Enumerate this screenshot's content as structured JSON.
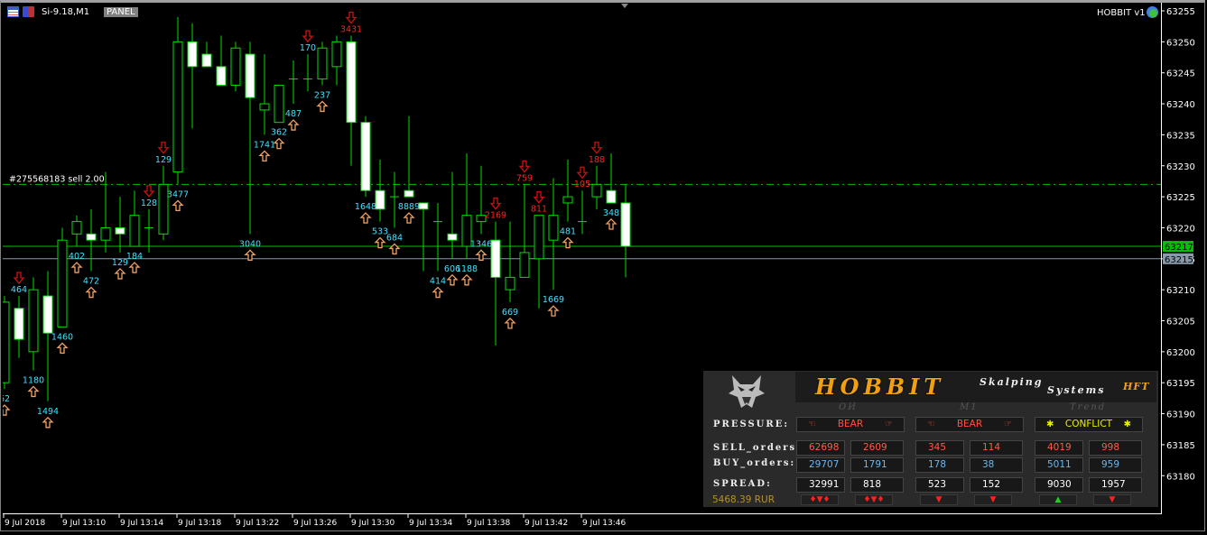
{
  "header": {
    "symbol": "Si-9.18,M1",
    "panel_button": "PANEL",
    "ea_name": "HOBBIT v1"
  },
  "order_line": {
    "label": "#275568183 sell 2.00",
    "price": 63227
  },
  "colors": {
    "bull_outline": "#00e000",
    "bear_fill": "#ffffff",
    "bid_line": "#00c000",
    "ask_line": "#8899aa",
    "up_label": "#40e0ff",
    "down_label": "#ff2020",
    "brand": "#f0a010"
  },
  "chart_data": {
    "type": "candlestick",
    "ylim": [
      63176,
      63256
    ],
    "y_ticks": [
      "63255",
      "63250",
      "63245",
      "63240",
      "63235",
      "63230",
      "63225",
      "63220",
      "63215",
      "63210",
      "63205",
      "63200",
      "63195",
      "63190",
      "63185",
      "63180"
    ],
    "x_ticks": [
      "9 Jul 2018",
      "9 Jul 13:10",
      "9 Jul 13:14",
      "9 Jul 13:18",
      "9 Jul 13:22",
      "9 Jul 13:26",
      "9 Jul 13:30",
      "9 Jul 13:34",
      "9 Jul 13:38",
      "9 Jul 13:42",
      "9 Jul 13:46"
    ],
    "bid_price": "63217",
    "ask_price": "63215",
    "candles": [
      [
        63195,
        63209,
        63194,
        63208
      ],
      [
        63207,
        63209,
        63199,
        63202
      ],
      [
        63200,
        63212,
        63197,
        63210
      ],
      [
        63209,
        63213,
        63192,
        63203
      ],
      [
        63204,
        63220,
        63204,
        63218
      ],
      [
        63219,
        63222,
        63217,
        63221
      ],
      [
        63219,
        63223,
        63213,
        63218
      ],
      [
        63218,
        63229,
        63216,
        63220
      ],
      [
        63220,
        63225,
        63216,
        63219
      ],
      [
        63217,
        63226,
        63217,
        63222
      ],
      [
        63220,
        63223,
        63216,
        63220
      ],
      [
        63219,
        63230,
        63218,
        63227
      ],
      [
        63229,
        63254,
        63227,
        63250
      ],
      [
        63250,
        63253,
        63236,
        63246
      ],
      [
        63248,
        63250,
        63246,
        63246
      ],
      [
        63246,
        63251,
        63243,
        63243
      ],
      [
        63243,
        63250,
        63242,
        63249
      ],
      [
        63248,
        63250,
        63219,
        63241
      ],
      [
        63239,
        63248,
        63235,
        63240
      ],
      [
        63237,
        63243,
        63237,
        63243
      ],
      [
        63244,
        63247,
        63240,
        63244
      ],
      [
        63244,
        63248,
        63242,
        63244
      ],
      [
        63244,
        63250,
        63243,
        63249
      ],
      [
        63246,
        63251,
        63243,
        63250
      ],
      [
        63250,
        63251,
        63230,
        63237
      ],
      [
        63237,
        63238,
        63225,
        63226
      ],
      [
        63226,
        63231,
        63221,
        63223
      ],
      [
        63225,
        63229,
        63220,
        63225
      ],
      [
        63226,
        63238,
        63225,
        63225
      ],
      [
        63224,
        63224,
        63213,
        63223
      ],
      [
        63221,
        63224,
        63213,
        63221
      ],
      [
        63219,
        63229,
        63215,
        63218
      ],
      [
        63217,
        63232,
        63215,
        63222
      ],
      [
        63221,
        63230,
        63219,
        63222
      ],
      [
        63218,
        63221,
        63201,
        63212
      ],
      [
        63210,
        63221,
        63208,
        63212
      ],
      [
        63212,
        63227,
        63212,
        63216
      ],
      [
        63215,
        63222,
        63207,
        63222
      ],
      [
        63218,
        63228,
        63210,
        63222
      ],
      [
        63224,
        63231,
        63221,
        63225
      ],
      [
        63221,
        63226,
        63219,
        63221
      ],
      [
        63225,
        63230,
        63223,
        63227
      ],
      [
        63226,
        63232,
        63224,
        63224
      ],
      [
        63224,
        63227,
        63212,
        63217
      ]
    ],
    "signals": [
      {
        "candle": 0,
        "dir": "up",
        "label": "62"
      },
      {
        "candle": 1,
        "dir": "down",
        "label": "464",
        "label_color": "cyan"
      },
      {
        "candle": 2,
        "dir": "up",
        "label": "1180"
      },
      {
        "candle": 3,
        "dir": "up",
        "label": "1494"
      },
      {
        "candle": 4,
        "dir": "up",
        "label": "1460"
      },
      {
        "candle": 5,
        "dir": "up",
        "label": "402"
      },
      {
        "candle": 6,
        "dir": "up",
        "label": "472"
      },
      {
        "candle": 8,
        "dir": "up",
        "label": "129"
      },
      {
        "candle": 9,
        "dir": "up",
        "label": "184"
      },
      {
        "candle": 10,
        "dir": "down",
        "label": "128",
        "label_color": "cyan"
      },
      {
        "candle": 11,
        "dir": "down",
        "label": "129",
        "label_color": "cyan"
      },
      {
        "candle": 12,
        "dir": "up",
        "label": "3477"
      },
      {
        "candle": 17,
        "dir": "up",
        "label": "3040"
      },
      {
        "candle": 18,
        "dir": "up",
        "label": "1741"
      },
      {
        "candle": 19,
        "dir": "up",
        "label": "362"
      },
      {
        "candle": 20,
        "dir": "up",
        "label": "487"
      },
      {
        "candle": 21,
        "dir": "down",
        "label": "170",
        "label_color": "cyan"
      },
      {
        "candle": 22,
        "dir": "up",
        "label": "237"
      },
      {
        "candle": 24,
        "dir": "down",
        "label": "3431",
        "label_color": "red"
      },
      {
        "candle": 25,
        "dir": "up",
        "label": "1648"
      },
      {
        "candle": 26,
        "dir": "up",
        "label": "533"
      },
      {
        "candle": 27,
        "dir": "up",
        "label": "684"
      },
      {
        "candle": 28,
        "dir": "up",
        "label": "8889"
      },
      {
        "candle": 30,
        "dir": "up",
        "label": "414"
      },
      {
        "candle": 31,
        "dir": "up",
        "label": "606"
      },
      {
        "candle": 32,
        "dir": "up",
        "label": "1188"
      },
      {
        "candle": 33,
        "dir": "up",
        "label": "1346"
      },
      {
        "candle": 34,
        "dir": "down",
        "label": "2169",
        "label_color": "red"
      },
      {
        "candle": 35,
        "dir": "up",
        "label": "669"
      },
      {
        "candle": 36,
        "dir": "down",
        "label": "759",
        "label_color": "red"
      },
      {
        "candle": 37,
        "dir": "down",
        "label": "811",
        "label_color": "red"
      },
      {
        "candle": 38,
        "dir": "up",
        "label": "1669"
      },
      {
        "candle": 39,
        "dir": "up",
        "label": "481"
      },
      {
        "candle": 40,
        "dir": "down",
        "label": "105",
        "label_color": "red"
      },
      {
        "candle": 41,
        "dir": "down",
        "label": "188",
        "label_color": "red"
      },
      {
        "candle": 42,
        "dir": "up",
        "label": "348"
      }
    ]
  },
  "hud": {
    "brand": "HOBBIT",
    "sub1": "Skalping",
    "sub2": "Systems",
    "hft": "HFT",
    "columns": [
      "OИ",
      "M1",
      "Trend"
    ],
    "rows": {
      "pressure": "PRESSURE:",
      "sell": "SELL_orders:",
      "buy": "BUY_orders:",
      "spread": "SPREAD:"
    },
    "pressure": [
      "BEAR",
      "BEAR",
      "CONFLICT"
    ],
    "sell": [
      "62698",
      "2609",
      "345",
      "114",
      "4019",
      "998"
    ],
    "buy": [
      "29707",
      "1791",
      "178",
      "38",
      "5011",
      "959"
    ],
    "spread": [
      "32991",
      "818",
      "523",
      "152",
      "9030",
      "1957"
    ],
    "balance": "5468.39 RUR",
    "mini_signals": [
      "♦▼♦",
      "♦▼♦",
      "▼",
      "▼",
      "▲",
      "▼"
    ]
  }
}
